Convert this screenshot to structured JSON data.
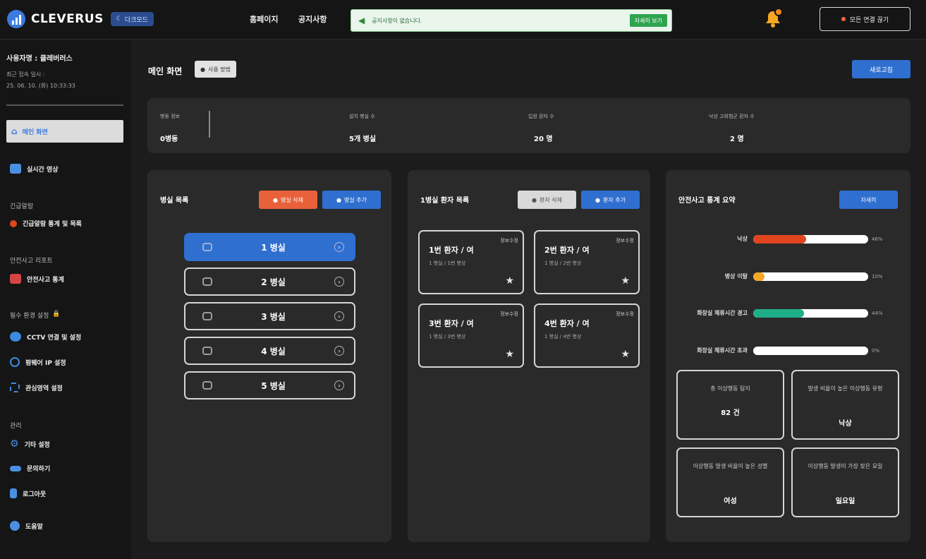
{
  "header": {
    "brand": "CLEVERUS",
    "dark_mode_label": "다크모드",
    "nav": [
      "홈페이지",
      "공지사항"
    ],
    "notice_text": "공지사항이 없습니다.",
    "notice_button": "자세히 보기",
    "disconnect_label": "모든 연결 끊기"
  },
  "sidebar": {
    "user": "사용자명 : 클레버러스",
    "last_login_label": "최근 접속 일시 :",
    "last_login_time": "25. 06. 10. (화) 10:33:33",
    "menu_active": "메인 화면",
    "realtime": "실시간 영상",
    "section_emergency": "긴급알람",
    "emergency_stats": "긴급알람 통계 및 목록",
    "section_report": "안전사고 리포트",
    "accident_stats": "안전사고 통계",
    "section_env": "필수 환경 설정",
    "cctv": "CCTV 연결 및 설정",
    "firmware_ip": "펌웨어 IP 설정",
    "roi": "관심영역 설정",
    "section_manage": "관리",
    "other_settings": "기타 설정",
    "inquiry": "문의하기",
    "logout": "로그아웃",
    "help": "도움말"
  },
  "main": {
    "title": "메인 화면",
    "howto": "사용 방법",
    "refresh": "새로고침",
    "stats": [
      {
        "label": "병동 정보",
        "value": "0병동"
      },
      {
        "label": "설치 병실 수",
        "value": "5개 병실"
      },
      {
        "label": "입원 환자 수",
        "value": "20 명"
      },
      {
        "label": "낙상 고위험군 환자 수",
        "value": "2 명"
      }
    ]
  },
  "rooms": {
    "title": "병실 목록",
    "delete": "병실 삭제",
    "add": "병실 추가",
    "items": [
      "1 병실",
      "2 병실",
      "3 병실",
      "4 병실",
      "5 병실"
    ]
  },
  "patients": {
    "title": "1병실 환자 목록",
    "delete": "환자 삭제",
    "add": "환자 추가",
    "items": [
      {
        "name": "1번 환자 / 여",
        "tag": "정보수정",
        "room": "1 병실 / 1번 병상"
      },
      {
        "name": "2번 환자 / 여",
        "tag": "정보수정",
        "room": "1 병실 / 2번 병상"
      },
      {
        "name": "3번 환자 / 여",
        "tag": "정보수정",
        "room": "1 병실 / 3번 병상"
      },
      {
        "name": "4번 환자 / 여",
        "tag": "정보수정",
        "room": "1 병실 / 4번 병상"
      }
    ]
  },
  "accident": {
    "title": "안전사고 통계 요약",
    "detail": "자세히",
    "bars": [
      {
        "label": "낙상",
        "value": 46,
        "pct": "46%",
        "color": "#e0451f"
      },
      {
        "label": "병상 이탈",
        "value": 10,
        "pct": "10%",
        "color": "#f5a623"
      },
      {
        "label": "화장실 체류시간 경고",
        "value": 44,
        "pct": "44%",
        "color": "#1fae8a"
      },
      {
        "label": "화장실 체류시간 초과",
        "value": 0,
        "pct": "0%",
        "color": "#888888"
      }
    ],
    "cards": [
      {
        "label": "총 이상행동 탐지",
        "value": "82 건"
      },
      {
        "label": "발생 비율이 높은 이상행동 유형",
        "value": "낙상"
      },
      {
        "label": "이상행동 발생 비율이 높은 성별",
        "value": "여성"
      },
      {
        "label": "이상행동 발생이 가장 잦은 요일",
        "value": "일요일"
      }
    ]
  }
}
